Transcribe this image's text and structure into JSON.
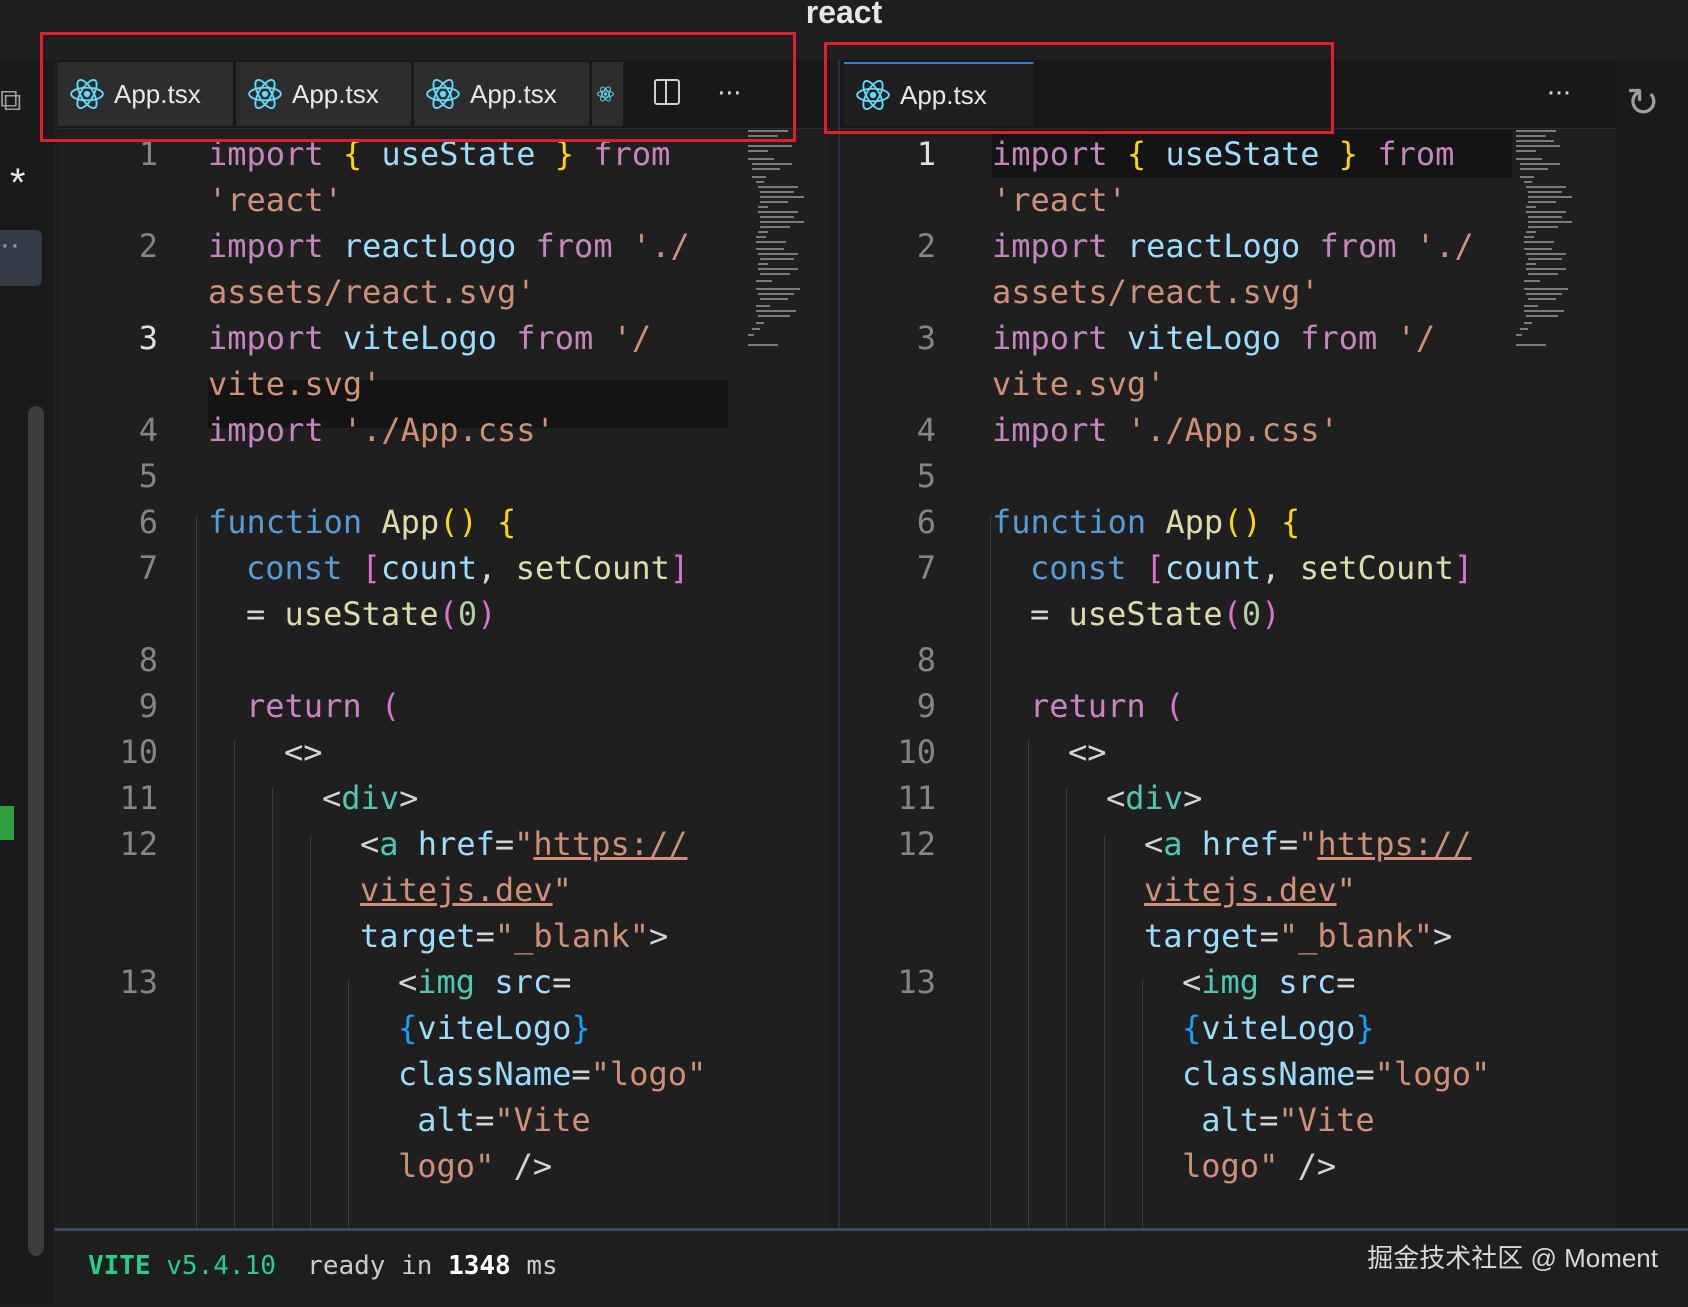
{
  "window": {
    "title": "react"
  },
  "colors": {
    "accent": "#3a7bd5",
    "annotation": "#e0202a",
    "vite_green": "#23d18b"
  },
  "icons": [
    "react-icon",
    "split-editor-icon",
    "more-actions-icon",
    "refresh-icon"
  ],
  "left_group": {
    "tabs": [
      {
        "label": "App.tsx"
      },
      {
        "label": "App.tsx"
      },
      {
        "label": "App.tsx"
      },
      {
        "label": ""
      }
    ],
    "actions": {
      "split": "◫",
      "more": "···"
    }
  },
  "right_group": {
    "tabs": [
      {
        "label": "App.tsx"
      }
    ],
    "actions": {
      "more": "···"
    }
  },
  "activity": {
    "dirty_marker": "*",
    "dots": "··"
  },
  "editor": {
    "line_numbers": [
      "1",
      "2",
      "3",
      "4",
      "5",
      "6",
      "7",
      "8",
      "9",
      "10",
      "11",
      "12",
      "13"
    ],
    "current_line_left": "3",
    "current_line_right": "1"
  },
  "terminal": {
    "vite_name": "VITE",
    "vite_version": "v5.4.10",
    "ready": "ready in",
    "time_value": "1348",
    "time_unit": "ms"
  },
  "watermark": "掘金技术社区 @ Moment"
}
